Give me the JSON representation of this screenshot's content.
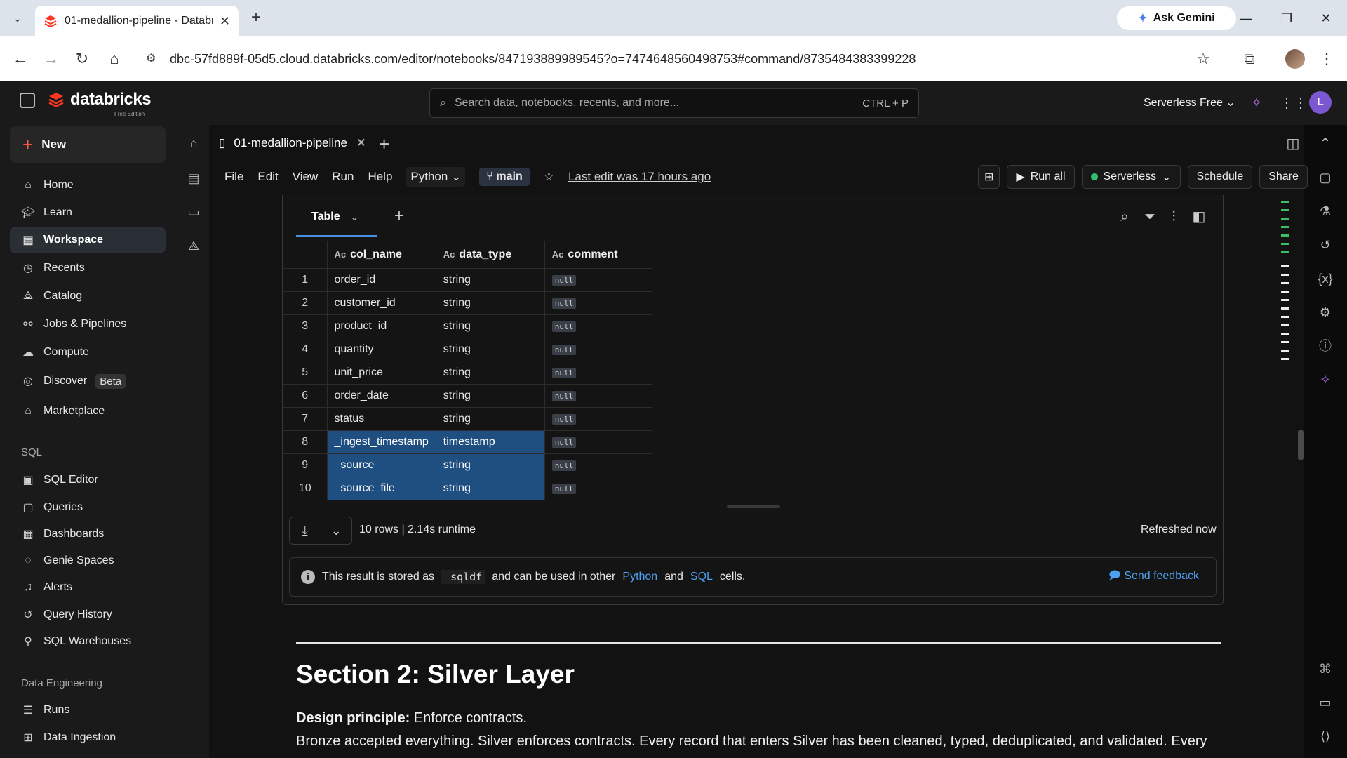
{
  "browser": {
    "tab_title": "01-medallion-pipeline - Databri",
    "ask_gemini": "Ask Gemini",
    "url": "dbc-57fd889f-05d5.cloud.databricks.com/editor/notebooks/847193889989545?o=7474648560498753#command/8735484383399228"
  },
  "app": {
    "logo_text": "databricks",
    "logo_sub": "Free Edition",
    "search_placeholder": "Search data, notebooks, recents, and more...",
    "search_shortcut": "CTRL + P",
    "workspace_label": "Serverless Free",
    "user_initial": "L"
  },
  "sidebar": {
    "new_label": "New",
    "items": [
      {
        "label": "Home",
        "icon": "home-icon"
      },
      {
        "label": "Learn",
        "icon": "learn-icon"
      },
      {
        "label": "Workspace",
        "icon": "workspace-icon",
        "active": true
      },
      {
        "label": "Recents",
        "icon": "clock-icon"
      },
      {
        "label": "Catalog",
        "icon": "catalog-icon"
      },
      {
        "label": "Jobs & Pipelines",
        "icon": "jobs-icon"
      },
      {
        "label": "Compute",
        "icon": "cloud-icon"
      },
      {
        "label": "Discover",
        "icon": "compass-icon",
        "badge": "Beta"
      },
      {
        "label": "Marketplace",
        "icon": "store-icon"
      }
    ],
    "sql_section": "SQL",
    "sql_items": [
      {
        "label": "SQL Editor"
      },
      {
        "label": "Queries"
      },
      {
        "label": "Dashboards"
      },
      {
        "label": "Genie Spaces"
      },
      {
        "label": "Alerts"
      },
      {
        "label": "Query History"
      },
      {
        "label": "SQL Warehouses"
      }
    ],
    "de_section": "Data Engineering",
    "de_items": [
      {
        "label": "Runs"
      },
      {
        "label": "Data Ingestion"
      }
    ]
  },
  "notebook": {
    "tab_name": "01-medallion-pipeline",
    "menu": [
      "File",
      "Edit",
      "View",
      "Run",
      "Help"
    ],
    "language": "Python",
    "branch": "main",
    "last_edit": "Last edit was 17 hours ago",
    "run_all": "Run all",
    "compute": "Serverless",
    "schedule": "Schedule",
    "share": "Share"
  },
  "result": {
    "tab_label": "Table",
    "columns": [
      "col_name",
      "data_type",
      "comment"
    ],
    "rows": [
      {
        "n": "1",
        "col_name": "order_id",
        "data_type": "string",
        "comment": "null"
      },
      {
        "n": "2",
        "col_name": "customer_id",
        "data_type": "string",
        "comment": "null"
      },
      {
        "n": "3",
        "col_name": "product_id",
        "data_type": "string",
        "comment": "null"
      },
      {
        "n": "4",
        "col_name": "quantity",
        "data_type": "string",
        "comment": "null"
      },
      {
        "n": "5",
        "col_name": "unit_price",
        "data_type": "string",
        "comment": "null"
      },
      {
        "n": "6",
        "col_name": "order_date",
        "data_type": "string",
        "comment": "null"
      },
      {
        "n": "7",
        "col_name": "status",
        "data_type": "string",
        "comment": "null"
      },
      {
        "n": "8",
        "col_name": "_ingest_timestamp",
        "data_type": "timestamp",
        "comment": "null",
        "selected": true
      },
      {
        "n": "9",
        "col_name": "_source",
        "data_type": "string",
        "comment": "null",
        "selected": true
      },
      {
        "n": "10",
        "col_name": "_source_file",
        "data_type": "string",
        "comment": "null",
        "selected": true
      }
    ],
    "row_count": "10 rows",
    "runtime": "2.14s runtime",
    "refreshed": "Refreshed now",
    "info_prefix": "This result is stored as",
    "info_var": "_sqldf",
    "info_mid": "and can be used in other",
    "info_python": "Python",
    "info_and": "and",
    "info_sql": "SQL",
    "info_suffix": "cells.",
    "feedback": "Send feedback"
  },
  "markdown": {
    "section_title": "Section 2: Silver Layer",
    "design_label": "Design principle:",
    "design_text": " Enforce contracts.",
    "paragraph": "Bronze accepted everything. Silver enforces contracts. Every record that enters Silver has been cleaned, typed, deduplicated, and validated. Every"
  },
  "colors": {
    "accent": "#4a90e2",
    "selection": "#1f4f80",
    "brand": "#ff3621",
    "status_green": "#2fbf71"
  }
}
